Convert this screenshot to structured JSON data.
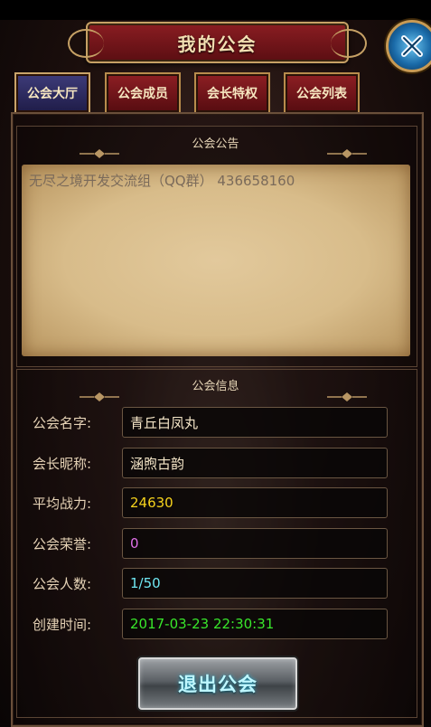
{
  "title": "我的公会",
  "colors": {
    "tab_active": "#2e2b62",
    "tab_inactive": "#7a1a1f",
    "value_yellow": "#f5d21c",
    "value_magenta": "#e070e8",
    "value_cyan": "#6fe7f2",
    "value_green": "#39e62b",
    "value_cream": "#f5e6c8"
  },
  "tabs": [
    {
      "label": "公会大厅",
      "active": true
    },
    {
      "label": "公会成员",
      "active": false
    },
    {
      "label": "会长特权",
      "active": false
    },
    {
      "label": "公会列表",
      "active": false
    }
  ],
  "notice": {
    "title": "公会公告",
    "text": "无尽之境开发交流组（QQ群） 436658160"
  },
  "info": {
    "title": "公会信息",
    "rows": [
      {
        "label": "公会名字:",
        "value": "青丘白凤丸"
      },
      {
        "label": "会长昵称:",
        "value": "涵煦古韵"
      },
      {
        "label": "平均战力:",
        "value": "24630"
      },
      {
        "label": "公会荣誉:",
        "value": "0"
      },
      {
        "label": "公会人数:",
        "value": "1/50"
      },
      {
        "label": "创建时间:",
        "value": "2017-03-23 22:30:31"
      }
    ]
  },
  "exit_button": "退出公会",
  "icons": {
    "close": "close-x-icon",
    "divider": "ornament-divider-icon"
  }
}
